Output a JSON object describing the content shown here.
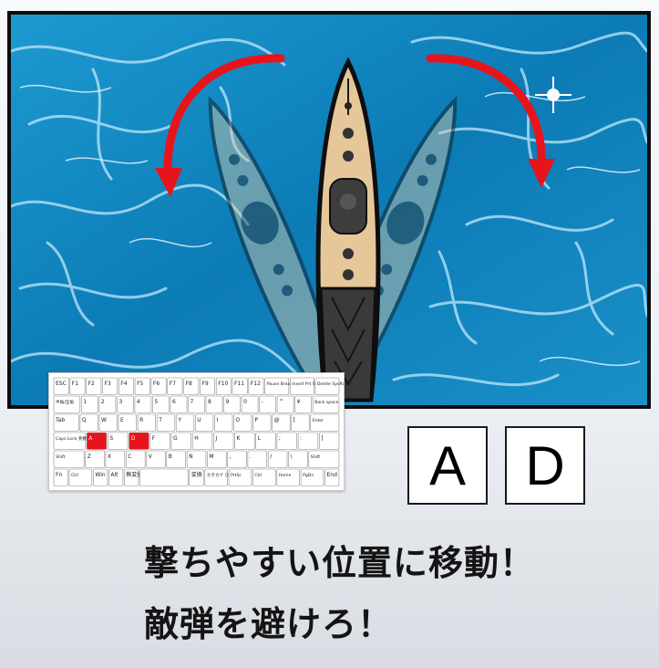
{
  "scene": {
    "turn_arrows": [
      "turn-left-arrow",
      "turn-right-arrow"
    ],
    "colors": {
      "water": "#0f7fb9",
      "kayak_body": "#e5c79a",
      "arrow": "#e8141c",
      "highlight_key": "#e8141c"
    }
  },
  "keyboard": {
    "highlighted_keys": [
      "A",
      "D"
    ],
    "rows": [
      [
        "ESC",
        "F1",
        "F2",
        "F3",
        "F4",
        "F5",
        "F6",
        "F7",
        "F8",
        "F9",
        "F10",
        "F11",
        "F12",
        "Pause Break",
        "Insert Prt Sc",
        "Delete SysRq"
      ],
      [
        "半角/全角",
        "1",
        "2",
        "3",
        "4",
        "5",
        "6",
        "7",
        "8",
        "9",
        "0",
        "-",
        "^",
        "¥",
        "Back space"
      ],
      [
        "Tab",
        "Q",
        "W",
        "E",
        "R",
        "T",
        "Y",
        "U",
        "I",
        "O",
        "P",
        "@",
        "[",
        "Enter"
      ],
      [
        "Caps Lock 英数",
        "A",
        "S",
        "D",
        "F",
        "G",
        "H",
        "J",
        "K",
        "L",
        ";",
        ":",
        "]"
      ],
      [
        "Shift",
        "Z",
        "X",
        "C",
        "V",
        "B",
        "N",
        "M",
        ",",
        ".",
        "/",
        "\\",
        "Shift"
      ],
      [
        "Fn",
        "Ctrl",
        "Win",
        "Alt",
        "無変換",
        "",
        "変換",
        "カタカナ ひらがな",
        "PrtSc",
        "Ctrl",
        "Home",
        "PgDn",
        "End"
      ]
    ]
  },
  "keys": {
    "a_label": "A",
    "d_label": "D"
  },
  "captions": {
    "line1": "撃ちやすい位置に移動！",
    "line2": "敵弾を避けろ！"
  }
}
